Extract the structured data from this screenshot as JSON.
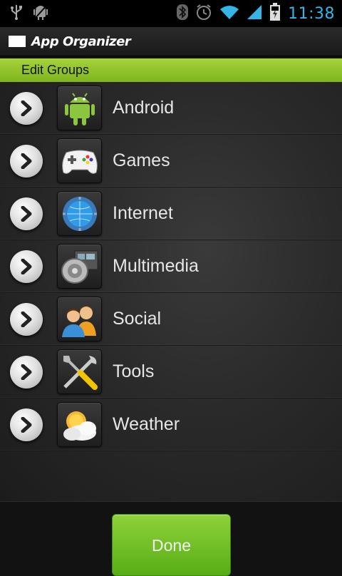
{
  "status_bar": {
    "time": "11:38",
    "icons": [
      "usb-icon",
      "android-debug-icon",
      "bluetooth-icon",
      "alarm-icon",
      "wifi-icon",
      "signal-icon",
      "battery-charging-icon"
    ],
    "accent": "#33b5e5"
  },
  "app": {
    "title": "App Organizer"
  },
  "group_bar": {
    "label": "Edit Groups",
    "color": "#8cc63f"
  },
  "groups": [
    {
      "label": "Android",
      "icon": "android-robot-icon"
    },
    {
      "label": "Games",
      "icon": "gamepad-icon"
    },
    {
      "label": "Internet",
      "icon": "globe-icon"
    },
    {
      "label": "Multimedia",
      "icon": "speaker-film-icon"
    },
    {
      "label": "Social",
      "icon": "people-icon"
    },
    {
      "label": "Tools",
      "icon": "tools-icon"
    },
    {
      "label": "Weather",
      "icon": "weather-icon"
    }
  ],
  "footer": {
    "done_label": "Done"
  }
}
